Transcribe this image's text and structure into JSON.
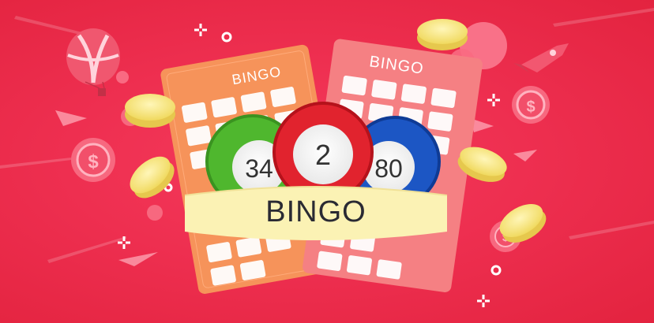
{
  "scene": {
    "banner_text": "BINGO",
    "left_card_title": "BINGO",
    "right_card_title": "BINGO",
    "balls": [
      {
        "number": "34",
        "color": "#4fb72e"
      },
      {
        "number": "2",
        "color": "#e1232e"
      },
      {
        "number": "80",
        "color": "#1c56c4"
      }
    ]
  },
  "colors": {
    "background": "#ee2f50",
    "left_card": "#f6935a",
    "right_card": "#f58083",
    "banner": "#fbf2b4",
    "coin": "#f4e47e"
  }
}
